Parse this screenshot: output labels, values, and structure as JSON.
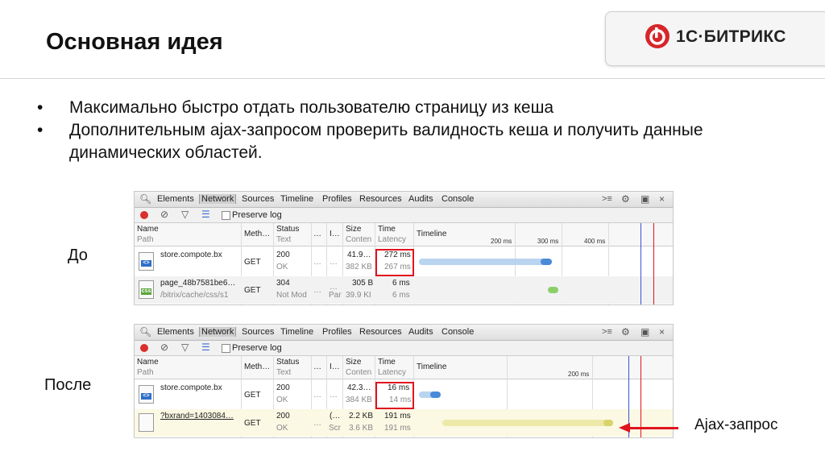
{
  "slide": {
    "title": "Основная идея",
    "bullets": [
      "Максимально быстро отдать пользователю  страницу из кеша",
      "Дополнительным ajax-запросом проверить валидность кеша и получить данные динамических областей."
    ],
    "label_before": "До",
    "label_after": "После",
    "ajax_label": "Ajax-запрос"
  },
  "logo": {
    "text": "1С·БИТРИКС",
    "color": "#d7262b"
  },
  "devtools": {
    "tabs": [
      "Elements",
      "Network",
      "Sources",
      "Timeline",
      "Profiles",
      "Resources",
      "Audits",
      "Console"
    ],
    "active_tab": "Network",
    "preserve_log": "Preserve log",
    "headers": {
      "name": "Name",
      "path": "Path",
      "method": "Meth…",
      "status": "Status",
      "text": "Text",
      "col3": "…",
      "col4": "I…",
      "size": "Size",
      "content": "Conten",
      "time": "Time",
      "latency": "Latency",
      "timeline": "Timeline"
    },
    "icons": [
      "search-icon",
      "record-icon",
      "clear-icon",
      "filter-icon",
      "list-icon",
      "console-icon",
      "gear-icon",
      "dock-icon",
      "close-icon"
    ]
  },
  "before": {
    "ticks": [
      "200 ms",
      "300 ms",
      "400 ms"
    ],
    "rows": [
      {
        "name": "store.compote.bx",
        "path": "",
        "method": "GET",
        "status": "200",
        "status_text": "OK",
        "c3": "…",
        "c4": "…",
        "size": "41.9…",
        "content": "382 KB",
        "time": "272 ms",
        "latency": "267 ms",
        "icon": "html-file-icon"
      },
      {
        "name": "page_48b7581be6…",
        "path": "/bitrix/cache/css/s1",
        "method": "GET",
        "status": "304",
        "status_text": "Not Mod",
        "c3": "…",
        "c4": "…",
        "c4b": "Par",
        "size": "305 B",
        "content": "39.9 KI",
        "time": "6 ms",
        "latency": "6 ms",
        "icon": "css-file-icon"
      }
    ]
  },
  "after": {
    "ticks": [
      "200 ms"
    ],
    "rows": [
      {
        "name": "store.compote.bx",
        "path": "",
        "method": "GET",
        "status": "200",
        "status_text": "OK",
        "c3": "…",
        "c4": "…",
        "size": "42.3…",
        "content": "384 KB",
        "time": "16 ms",
        "latency": "14 ms",
        "icon": "html-file-icon"
      },
      {
        "name": "?bxrand=1403084…",
        "path": "",
        "method": "GET",
        "status": "200",
        "status_text": "OK",
        "c3": "…",
        "c4": "(…",
        "c4b": "Scr",
        "size": "2.2 KB",
        "content": "3.6 KB",
        "time": "191 ms",
        "latency": "191 ms",
        "icon": "blank-file-icon"
      }
    ]
  },
  "colors": {
    "highlight_red": "#e0141e",
    "bar_blue": "#7fb4e6",
    "bar_green": "#8ccf6a",
    "bar_yellow": "#ede9a8"
  }
}
